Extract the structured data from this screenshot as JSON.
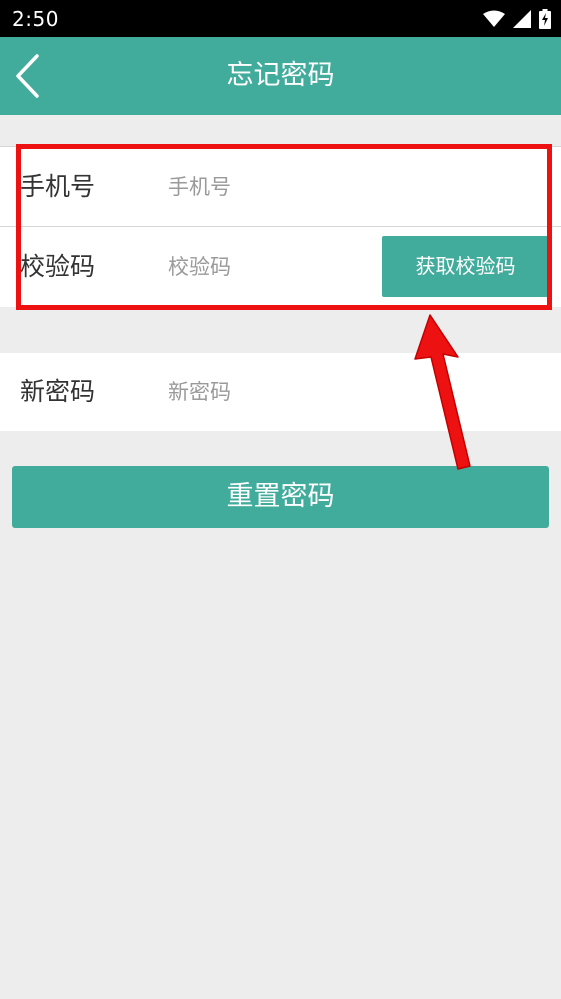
{
  "status_bar": {
    "time": "2:50",
    "icons": [
      "wifi-icon",
      "signal-icon",
      "battery-charging-icon"
    ]
  },
  "app_bar": {
    "title": "忘记密码",
    "back_icon": "chevron-left-icon"
  },
  "form": {
    "phone": {
      "label": "手机号",
      "placeholder": "手机号",
      "value": ""
    },
    "code": {
      "label": "校验码",
      "placeholder": "校验码",
      "value": "",
      "button_label": "获取校验码"
    },
    "new_password": {
      "label": "新密码",
      "placeholder": "新密码",
      "value": ""
    }
  },
  "reset_button_label": "重置密码",
  "colors": {
    "accent": "#42ac9c",
    "background": "#ededed",
    "annotation": "#ee1111",
    "status_bar": "#000000"
  }
}
